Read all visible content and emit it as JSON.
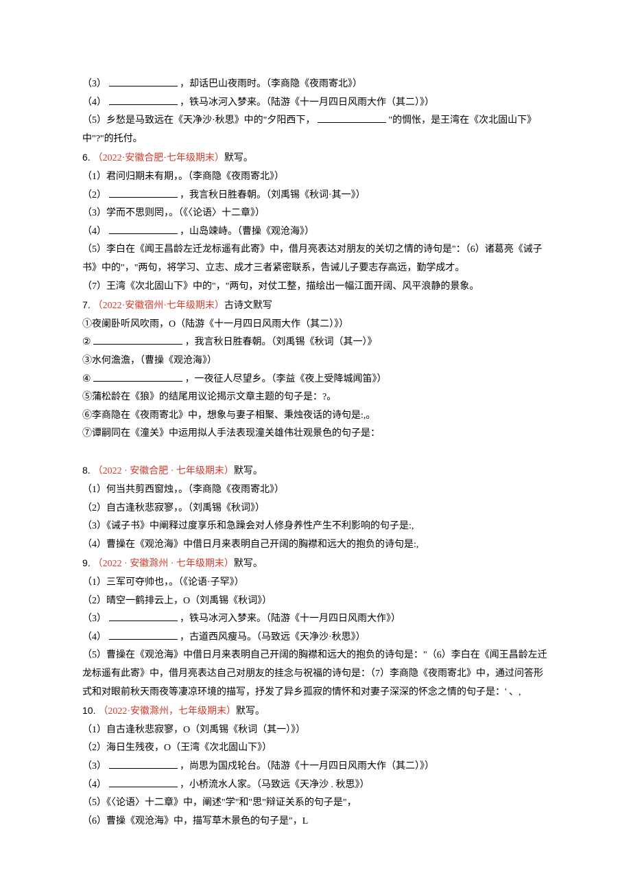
{
  "q5": {
    "l3": "（3）",
    "l3b": "，却话巴山夜雨时。（李商隐《夜雨寄北》）",
    "l4": "（4）",
    "l4b": "，铁马冰河入梦来。（陆游《十一月四日风雨大作（其二）》）",
    "l5a": "（5）乡愁是马致远在《天净沙·秋思》中的\"夕阳西下，",
    "l5b": "\"的惆怅，是王湾在《次北固山下》中\"?\"的托付。"
  },
  "q6": {
    "num": "6. ",
    "src": "（2022·安徽合肥·七年级期末）",
    "title": "默写。",
    "l1": "（1）君问归期未有期，。（李商隐《夜雨寄北》）",
    "l2": "（2）",
    "l2b": "，我言秋日胜春朝。（刘禹锡《秋词·其一》）",
    "l3": "（3）学而不思则罔，。（《〈论语〉十二章》）",
    "l4": "（4）",
    "l4b": "，山岛竦峙。（曹操《观沧海》）",
    "l5": "（5）李白在《闻王昌龄左迁龙标遥有此寄》中，借月亮表达对朋友的关切之情的诗句是\"：（6）诸葛亮《诫子书》中的\"，\"两句，将学习、立志、成才三者紧密联系，告诫儿子要志存高远，勤学成才。",
    "l7": "（7）王湾《次北固山下》中的\"，\"两句，对仗工整，描绘出一幅江面开阔、风平浪静的景象。"
  },
  "q7": {
    "num": "7. ",
    "src": "（2022·安徽宿州·七年级期末）",
    "title": "古诗文默写",
    "l1": "①夜阑卧听风吹雨，O（陆游《十一月四日风雨大作（其二）》）",
    "l2a": "②",
    "l2b": "，我言秋日胜春朝。（刘禹锡《秋词（其一）》",
    "l3": "③水何澹澹，（曹操《观沧海》）",
    "l4a": "④",
    "l4b": "，一夜征人尽望乡。（李益《夜上受降城闻笛》）",
    "l5": "⑤蒲松龄在《狼》的结尾用议论揭示文章主题的句子是：?。",
    "l6": "⑥李商隐在《夜雨寄北》中，想象与妻子相聚、秉烛夜话的诗句是:,。",
    "l7": "⑦谭嗣同在《潼关》中运用拟人手法表现潼关雄伟壮观景色的句子是："
  },
  "q8": {
    "num": "8. ",
    "src": "（2022 · 安徽合肥 · 七年级期末）",
    "title": "默写。",
    "l1": "（1）何当共剪西窗烛，。（李商隐《夜雨寄北》）",
    "l2": "（2）自古逢秋悲寂寥，。（刘禹锡《秋词》）",
    "l3": "（3）《诫子书》中阐释过度享乐和急躁会对人修身养性产生不利影响的句子是:,",
    "l4": "（4）曹操在《观沧海》中借日月来表明自己开阔的胸襟和远大的抱负的诗句是:,"
  },
  "q9": {
    "num": "9. ",
    "src": "（2022 · 安徽滁州 · 七年级期末）",
    "title": "默写。",
    "l1": "（1）三军可夺帅也，。（《论语·子罕》）",
    "l2": "（2）晴空一鹤排云上，O（刘禹锡《秋词》）",
    "l3": "（3）",
    "l3b": "，铁马冰河入梦来。（陆游《十一月四日风雨大作》）",
    "l4": "（4）",
    "l4b": "，古道西风瘦马。（马致远《天净沙·秋思》）",
    "l5": "（5）曹操在《观沧海》中借日月来表明自己开阔的胸襟和远大的抱负的诗句是：\"（6）李白在《闻王昌龄左迁龙标遥有此寄》中，借月亮表达自己对朋友的挂念与祝福的诗句是：（7）李商隐《夜雨寄北》中，通过问答形式和对眼前秋天雨夜等凄凉环境的描写，抒发了异乡孤寂的情怀和对妻子深深的怀念之情的句子是：' 、,"
  },
  "q10": {
    "num": "10. ",
    "src": "（2022·安徽滁州，七年级期末）",
    "title": "默写。",
    "l1": "（1）自古逢秋悲寂寥，O（刘禹锡《秋词（其一）》）",
    "l2": "（2）海日生残夜，O（王湾《次北固山下》）",
    "l3": "（3）",
    "l3b": "，尚思为国戍轮台。（陆游《十一月四日风雨大作（其二）》）",
    "l4": "（4）",
    "l4b": "，小桥流水人家。（马致远《天净沙 . 秋思》）",
    "l5": "（5）《〈论语〉十二章》中，阐述\"学\"和\"思\"辩证关系的句子是\"，",
    "l6": "（6）曹操《观沧海》中，描写草木景色的句子是\"，L"
  }
}
